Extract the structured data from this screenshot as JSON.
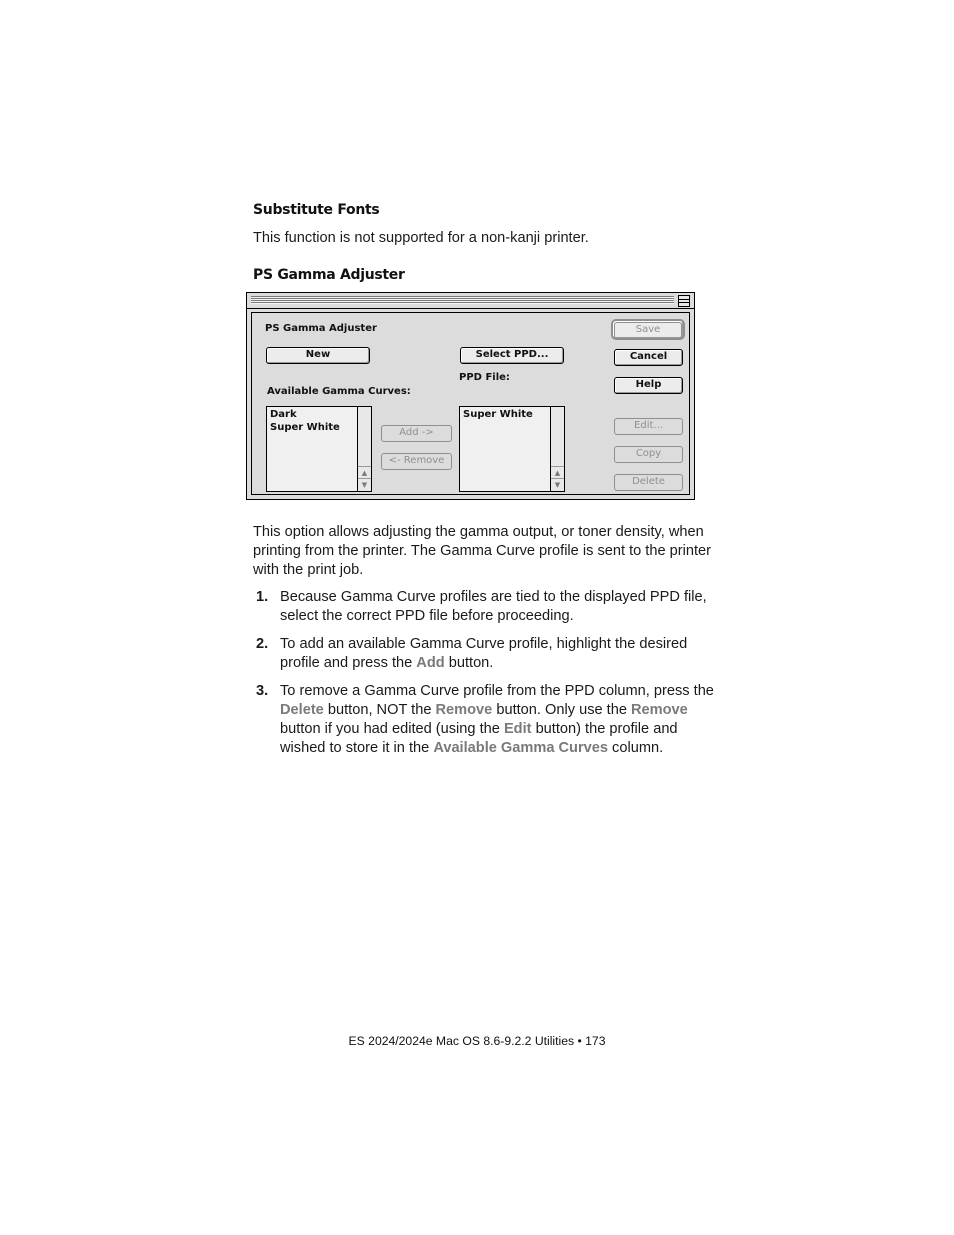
{
  "sections": {
    "substitute_fonts": {
      "heading": "Substitute Fonts",
      "body": "This function is not supported for a non-kanji printer."
    },
    "ps_gamma": {
      "heading": "PS Gamma Adjuster"
    }
  },
  "dialog": {
    "title": "PS Gamma Adjuster",
    "buttons": {
      "new": "New",
      "select_ppd": "Select PPD...",
      "save": "Save",
      "cancel": "Cancel",
      "help": "Help",
      "add": "Add ->",
      "remove": "<- Remove",
      "edit": "Edit...",
      "copy": "Copy",
      "delete": "Delete"
    },
    "labels": {
      "available_curves": "Available Gamma Curves:",
      "ppd_file": "PPD File:"
    },
    "available_curves": [
      "Dark",
      "Super White"
    ],
    "ppd_curves": [
      "Super White"
    ],
    "icons": {
      "collapse": "window-collapse-icon",
      "scroll_up": "▲",
      "scroll_down": "▼"
    }
  },
  "description": {
    "intro": "This option allows adjusting the gamma output, or toner density, when printing from the printer.  The Gamma Curve profile is sent to the printer with the print job.",
    "steps": [
      {
        "num": "1.",
        "parts": [
          {
            "t": "Because Gamma Curve profiles are tied to the displayed PPD file, select the correct PPD file before proceeding."
          }
        ]
      },
      {
        "num": "2.",
        "parts": [
          {
            "t": "To add an available Gamma Curve profile, highlight the desired profile and press the "
          },
          {
            "t": "Add",
            "hl": true
          },
          {
            "t": " button."
          }
        ]
      },
      {
        "num": "3.",
        "parts": [
          {
            "t": "To remove a Gamma Curve profile from the PPD column, press the "
          },
          {
            "t": "Delete",
            "hl": true
          },
          {
            "t": " button, NOT the "
          },
          {
            "t": "Remove",
            "hl": true
          },
          {
            "t": " button.  Only use the "
          },
          {
            "t": "Remove",
            "hl": true
          },
          {
            "t": " button if you had edited (using the "
          },
          {
            "t": "Edit",
            "hl": true
          },
          {
            "t": " button) the profile and wished to store it in the "
          },
          {
            "t": "Available Gamma Curves",
            "hl": true
          },
          {
            "t": " column."
          }
        ]
      }
    ]
  },
  "colors": {
    "highlight_text": "#7a7a7a",
    "dialog_bg": "#dcdcdc"
  },
  "footer": "ES 2024/2024e Mac OS 8.6-9.2.2 Utilities  • 173"
}
